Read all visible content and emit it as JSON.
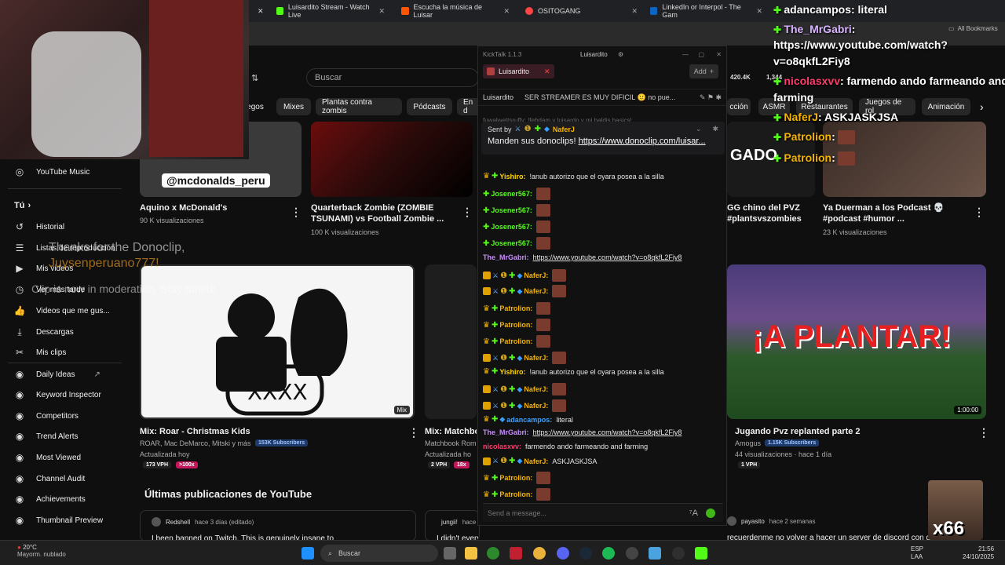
{
  "browser": {
    "tabs": [
      {
        "label": "Luisardito Stream - Watch Live",
        "color": "#53fc18"
      },
      {
        "label": "Escucha la música de Luisar",
        "color": "#ff5500"
      },
      {
        "label": "OSITOGANG",
        "color": "#ff4444"
      },
      {
        "label": "LinkedIn or Interpol - The Gam",
        "color": "#0a66c2"
      }
    ],
    "bookmarks_label": "All Bookmarks"
  },
  "youtube": {
    "search_placeholder": "Buscar",
    "chips": [
      "egos",
      "Mixes",
      "Plantas contra zombis",
      "Pódcasts",
      "En d",
      "cción",
      "ASMR",
      "Restaurantes",
      "Juegos de rol",
      "Animación"
    ],
    "stats": {
      "count1": "420.4K",
      "count2": "1,344"
    },
    "sidebar": {
      "yt_music": "YouTube Music",
      "you": "Tú",
      "items": [
        "Historial",
        "Listas de reproducción",
        "Mis videos",
        "Ver más tarde",
        "Videos que me gus...",
        "Descargas",
        "Mis clips"
      ],
      "tools": [
        "Daily Ideas",
        "Keyword Inspector",
        "Competitors",
        "Trend Alerts",
        "Most Viewed",
        "Channel Audit",
        "Achievements",
        "Thumbnail Preview"
      ]
    },
    "row1": [
      {
        "title": "Aquino x McDonald's",
        "meta": "90 K visualizaciones",
        "thumb_text": "@mcdonalds_peru"
      },
      {
        "title": "Quarterback Zombie (ZOMBIE TSUNAMI) vs Football Zombie ...",
        "meta": "100 K visualizaciones"
      },
      {
        "title": "GG chino del PVZ #plantsvszombies",
        "thumb_text": "GADO"
      },
      {
        "title": "Ya Duerman a los Podcast 💀 #podcast #humor ...",
        "meta": "23 K visualizaciones"
      }
    ],
    "row2": [
      {
        "title": "Mix: Roar - Christmas Kids",
        "channel": "ROAR, Mac DeMarco, Mitski y más",
        "subs": "153K Subscribers",
        "meta": "Actualizada hoy",
        "vph": "173 VPH",
        "badge": ">100x",
        "mix": "Mix"
      },
      {
        "title": "Mix: Matchbo",
        "channel": "Matchbook Rom",
        "meta": "Actualizada ho",
        "vph": "2 VPH",
        "badge": "18x"
      },
      {
        "title": "Jugando Pvz replanted parte 2",
        "channel": "Amogus",
        "subs": "1.15K Subscribers",
        "meta": "44 visualizaciones · hace 1 día",
        "vph": "1 VPH",
        "duration": "1:00:00",
        "thumb_text": "¡A PLANTAR!"
      }
    ],
    "section_title": "Últimas publicaciones de YouTube",
    "posts": [
      {
        "author": "Redshell",
        "time": "hace 3 días (editado)",
        "text": "I been banned on Twitch. This is genuinely insane to"
      },
      {
        "author": "jungii!",
        "time": "hace 1 mes",
        "text": "I didn't even know this was a thing on YouTube man I'm too use for this. Peat"
      },
      {
        "author": "payasito",
        "time": "hace 2 semanas",
        "text": "recuerdenme no volver a hacer un server de discord con gamers"
      }
    ]
  },
  "overlay": {
    "line1": "Thanks for the Donoclip,",
    "user": "Juysenperuano777!",
    "line2": "Clip is now in moderation. Stay tuned!"
  },
  "kicktalk": {
    "title": "KickTalk 1.1.3",
    "user": "Luisardito",
    "channel_chip": "Luisardito",
    "add_label": "Add",
    "stream_name": "Luisardito",
    "stream_title": "SER STREAMER ES MUY DIFICIL 🙂 no pue...",
    "pinned_sent_by": "Sent by",
    "pinned_user": "NaferJ",
    "pinned_text": "Manden sus donoclips!",
    "pinned_link": "https://www.donoclip.com/luisar...",
    "hidden_top": "fuwalwettsruffy: !febdam y luisardo y mi baldis basics!",
    "messages": [
      {
        "user": "Yishiro:",
        "color": "#ffd700",
        "text": "!anub autorizo que el oyara posea a la silla",
        "badges": "crown-grn"
      },
      {
        "user": "Josener567:",
        "color": "#53fc18",
        "emote": true,
        "badges": "grn"
      },
      {
        "user": "Josener567:",
        "color": "#53fc18",
        "emote": true,
        "badges": "grn"
      },
      {
        "user": "Josener567:",
        "color": "#53fc18",
        "emote": true,
        "badges": "grn"
      },
      {
        "user": "Josener567:",
        "color": "#53fc18",
        "emote": true,
        "badges": "grn"
      },
      {
        "user": "The_MrGabri:",
        "color": "#c78bff",
        "link": "https://www.youtube.com/watch?v=o8qkfL2Fiy8",
        "badges": ""
      },
      {
        "user": "NaferJ:",
        "color": "#f5b400",
        "emote": true,
        "badges": "full"
      },
      {
        "user": "NaferJ:",
        "color": "#f5b400",
        "emote": true,
        "badges": "full"
      },
      {
        "user": "Patrolion:",
        "color": "#f5b400",
        "emote": true,
        "badges": "crown-grn"
      },
      {
        "user": "Patrolion:",
        "color": "#f5b400",
        "emote": true,
        "badges": "crown-grn"
      },
      {
        "user": "Patrolion:",
        "color": "#f5b400",
        "emote": true,
        "badges": "crown-grn"
      },
      {
        "user": "NaferJ:",
        "color": "#f5b400",
        "emote": true,
        "badges": "full"
      },
      {
        "user": "Yishiro:",
        "color": "#ffd700",
        "text": "!anub autorizo que el oyara posea a la silla",
        "badges": "crown-grn"
      },
      {
        "user": "NaferJ:",
        "color": "#f5b400",
        "emote": true,
        "badges": "full"
      },
      {
        "user": "NaferJ:",
        "color": "#f5b400",
        "emote": true,
        "badges": "full"
      },
      {
        "user": "adancampos:",
        "color": "#3aa0ff",
        "text": "literal",
        "badges": "crown-grn-dia"
      },
      {
        "user": "The_MrGabri:",
        "color": "#c78bff",
        "link": "https://www.youtube.com/watch?v=o8qkfL2Fiy8",
        "badges": ""
      },
      {
        "user": "nicolasxvv:",
        "color": "#ff3b6b",
        "text": "farmendo ando farmeando and farming",
        "badges": ""
      },
      {
        "user": "NaferJ:",
        "color": "#f5b400",
        "text": "ASKJASKJSA",
        "badges": "full"
      },
      {
        "user": "Patrolion:",
        "color": "#f5b400",
        "emote": true,
        "badges": "crown-grn"
      },
      {
        "user": "Patrolion:",
        "color": "#f5b400",
        "emote": true,
        "badges": "crown-grn"
      }
    ],
    "send_placeholder": "Send a message..."
  },
  "twitch_overlay": {
    "lines": [
      {
        "user": "adancampos",
        "text": ": literal",
        "color": "#ffffff"
      },
      {
        "user": "The_MrGabri",
        "text": ":",
        "color": "#d8b4ff"
      },
      {
        "user": "",
        "text": "https://www.youtube.com/watch?",
        "color": "#ffffff"
      },
      {
        "user": "",
        "text": "v=o8qkfL2Fiy8",
        "color": "#ffffff"
      },
      {
        "user": "nicolasxvv",
        "text": ": farmendo ando farmeando and",
        "color": "#ff3b6b"
      },
      {
        "user": "",
        "text": "farming",
        "color": "#ffffff"
      },
      {
        "user": "NaferJ",
        "text": ": ASKJASKJSA",
        "color": "#f5b400"
      },
      {
        "user": "Patrolion",
        "text": ":",
        "color": "#f5b400"
      },
      {
        "user": "Patrolion",
        "text": ":",
        "color": "#f5b400"
      }
    ],
    "combo": "x66"
  },
  "taskbar": {
    "weather_temp": "20°C",
    "weather_desc": "Mayorm. nublado",
    "search": "Buscar",
    "lang": "ESP",
    "lang2": "LAA",
    "time": "21:56",
    "date": "24/10/2025"
  }
}
